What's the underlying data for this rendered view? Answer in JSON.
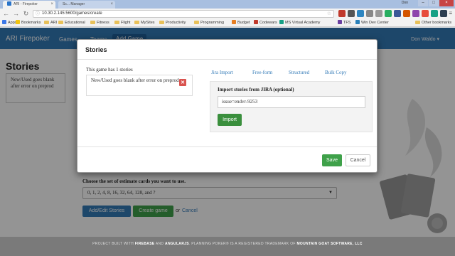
{
  "browser": {
    "tabs": [
      {
        "label": "ARI - Firepoker",
        "active": true
      },
      {
        "label": "Sc... Manager",
        "active": false
      }
    ],
    "window_user": "Don",
    "url": "10.30.2.145:5600/games/create",
    "bookmarks": [
      {
        "label": "Apps",
        "kind": "apps"
      },
      {
        "label": "Bookmarks",
        "kind": "star"
      },
      {
        "label": "ARI",
        "kind": "folder"
      },
      {
        "label": "Educational",
        "kind": "folder"
      },
      {
        "label": "Fitness",
        "kind": "folder"
      },
      {
        "label": "Flight",
        "kind": "folder"
      },
      {
        "label": "MySites",
        "kind": "folder"
      },
      {
        "label": "Productivity",
        "kind": "folder"
      },
      {
        "label": "Programming",
        "kind": "folder"
      },
      {
        "label": "Budget",
        "kind": "site"
      },
      {
        "label": "Codewars",
        "kind": "site"
      },
      {
        "label": "MS Virtual Academy",
        "kind": "site"
      },
      {
        "label": "TFS",
        "kind": "site"
      },
      {
        "label": "Win Dev Center",
        "kind": "site"
      },
      {
        "label": "Other bookmarks",
        "kind": "folder"
      }
    ]
  },
  "app": {
    "brand": "ARI Firepoker",
    "nav": {
      "games": "Games",
      "teams": "Teams",
      "add_game": "Add Game"
    },
    "user": "Don Waldo ▾",
    "left_title": "Stories",
    "left_story": "New/Used goes blank after error on preprod",
    "choose_label": "Choose the set of estimate cards you want to use.",
    "card_set": "0, 1, 2, 4, 8, 16, 32, 64, 128, and ?",
    "buttons": {
      "edit_stories": "Add/Edit Stories",
      "create_game": "Create game",
      "or": "or",
      "cancel": "Cancel"
    },
    "footer": {
      "p1": "PROJECT BUILT WITH ",
      "firebase": "FIREBASE",
      "p2": " AND ",
      "angular": "ANGULARJS",
      "p3": ". PLANNING POKER® IS A REGISTERED TRADEMARK OF ",
      "mgs": "MOUNTAIN GOAT SOFTWARE, LLC"
    }
  },
  "modal": {
    "title": "Stories",
    "count_text": "This game has 1 stories",
    "stories": [
      {
        "title": "New/Used goes blank after error on preprod"
      }
    ],
    "tabs": [
      "Jira Import",
      "Free-form",
      "Structured",
      "Bulk Copy"
    ],
    "jira_label": "Import stories from JIRA (optional)",
    "jira_input": "issue=endvr-9253",
    "import_button": "Import",
    "save_button": "Save",
    "cancel_button": "Cancel"
  },
  "colors": {
    "primary": "#337ab7",
    "success": "#3fa14a",
    "danger": "#d9534f"
  }
}
